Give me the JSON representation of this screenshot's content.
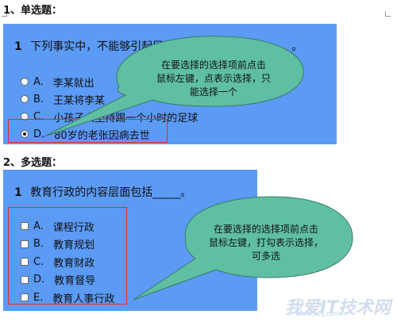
{
  "section1": {
    "title": "1、单选题：",
    "question_number": "1",
    "question_text": "下列事实中，不能够引起民事法律关系发生的是_____。",
    "options": [
      {
        "letter": "A.",
        "text": "李某就出",
        "checked": false
      },
      {
        "letter": "B.",
        "text": "王某将李某",
        "checked": false
      },
      {
        "letter": "C.",
        "text": "小孩子大坚持踢一个小时的足球",
        "checked": false
      },
      {
        "letter": "D.",
        "text": "80岁的老张因病去世",
        "checked": true
      }
    ],
    "callout_lines": [
      "在要选择的选择项前点击",
      "鼠标左键，点表示选择，只",
      "能选择一个"
    ]
  },
  "section2": {
    "title": "2、多选题：",
    "question_number": "1",
    "question_text": "教育行政的内容层面包括_____。",
    "options": [
      {
        "letter": "A.",
        "text": "课程行政",
        "checked": false
      },
      {
        "letter": "B.",
        "text": "教育规划",
        "checked": false
      },
      {
        "letter": "C.",
        "text": "教育财政",
        "checked": false
      },
      {
        "letter": "D.",
        "text": "教育督导",
        "checked": false
      },
      {
        "letter": "E.",
        "text": "教育人事行政",
        "checked": false
      }
    ],
    "callout_lines": [
      "在要选择的选择项前点击",
      "鼠标左键，打勾表示选择，",
      "可多选"
    ]
  },
  "watermark": {
    "text": "我爱IT技术网",
    "url": "www.52ij.com"
  },
  "colors": {
    "panel": "#5b9bf5",
    "callout": "#5fbfa3",
    "highlight_box": "#d8302d"
  }
}
